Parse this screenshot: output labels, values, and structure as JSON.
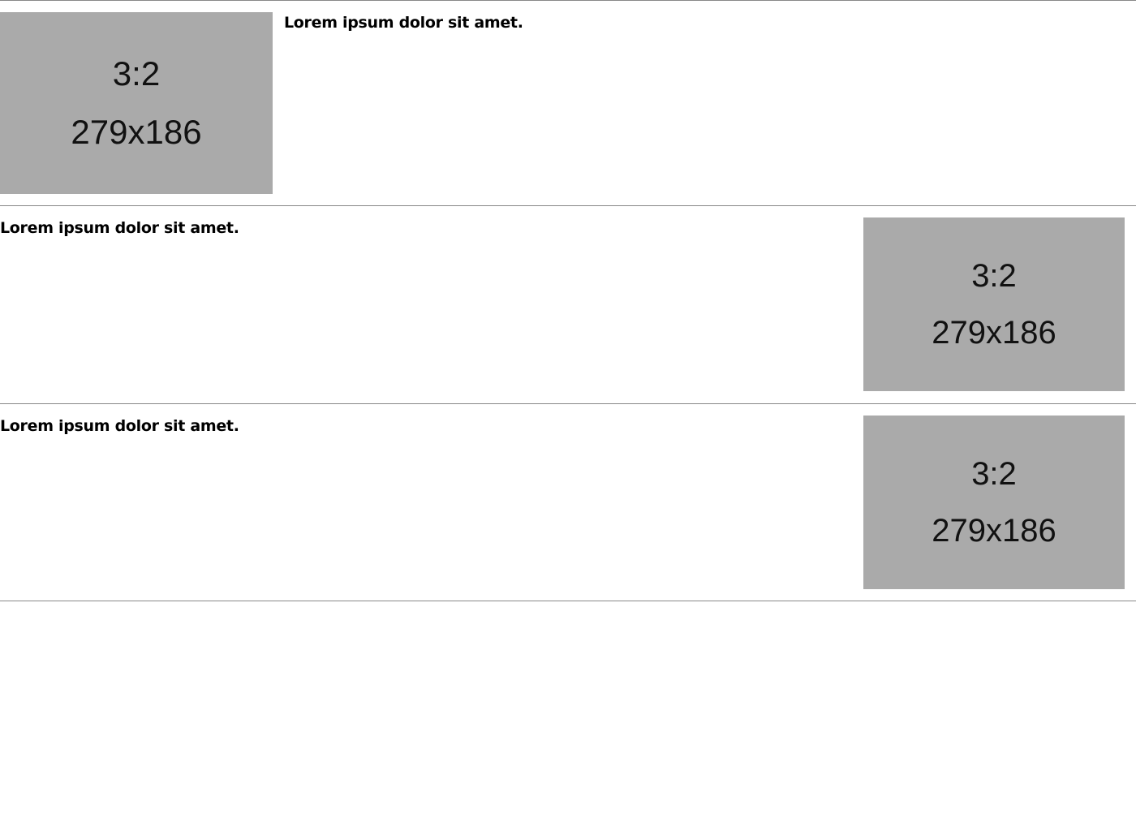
{
  "items": [
    {
      "heading": "Lorem ipsum dolor sit amet.",
      "image": {
        "ratio_label": "3:2",
        "size_label": "279x186"
      }
    },
    {
      "heading": "Lorem ipsum dolor sit amet.",
      "image": {
        "ratio_label": "3:2",
        "size_label": "279x186"
      }
    },
    {
      "heading": "Lorem ipsum dolor sit amet.",
      "image": {
        "ratio_label": "3:2",
        "size_label": "279x186"
      }
    }
  ],
  "colors": {
    "placeholder_bg": "#aaaaaa",
    "divider": "#888888",
    "page_bg": "#ffffff"
  }
}
